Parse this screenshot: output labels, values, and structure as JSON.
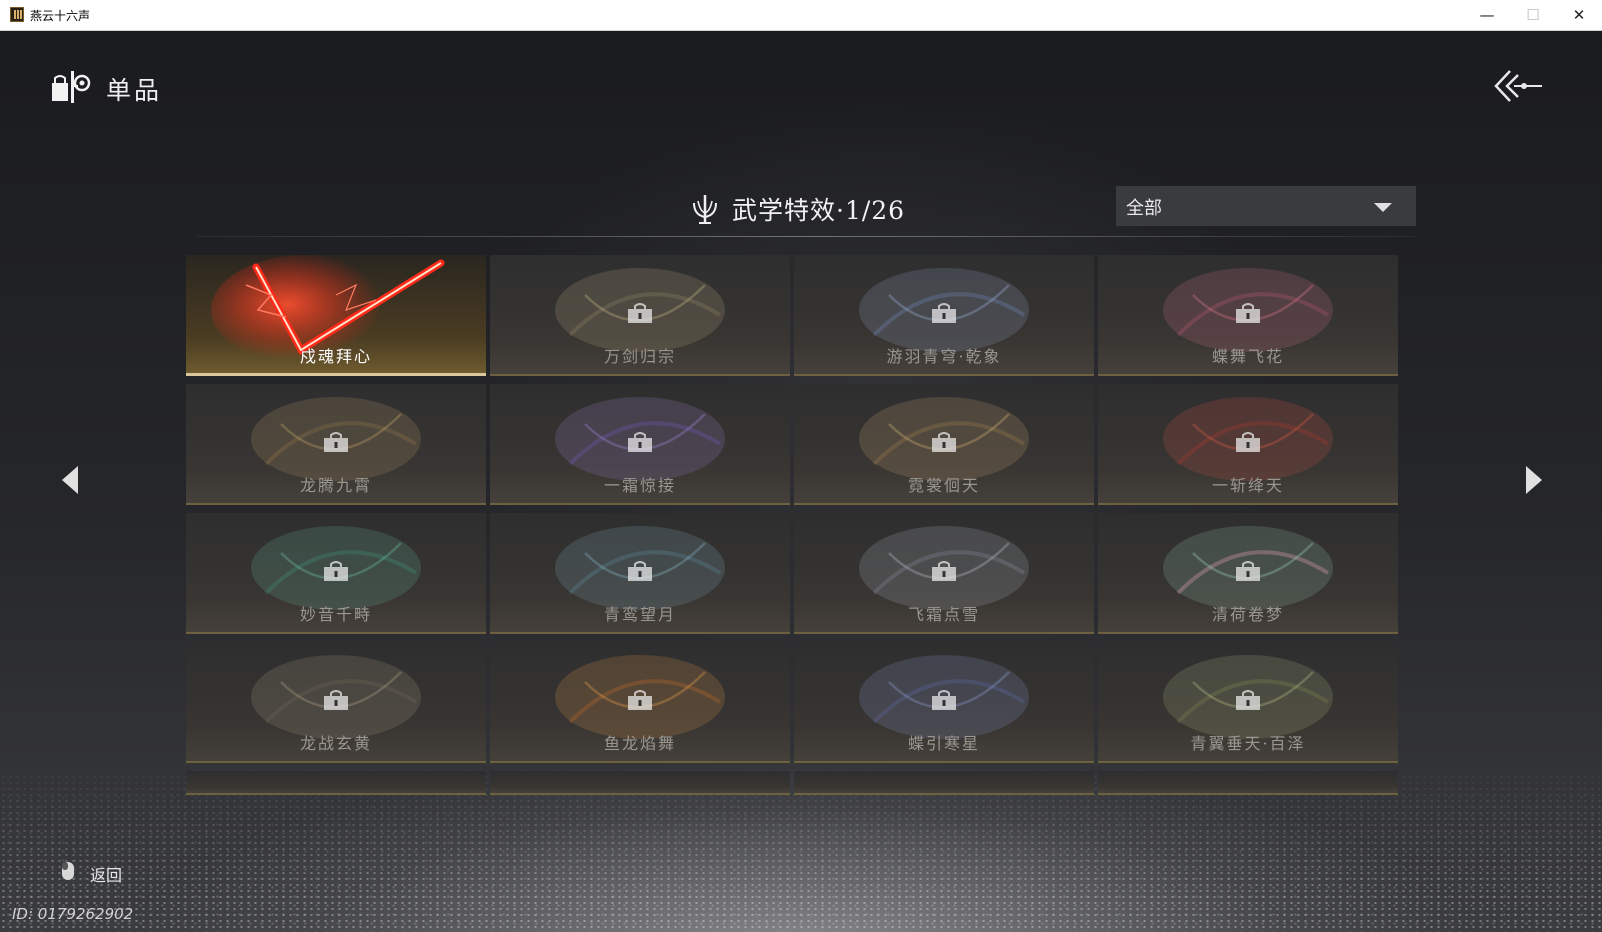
{
  "window": {
    "title": "燕云十六声",
    "minimize": "—",
    "maximize": "☐",
    "close": "✕"
  },
  "page": {
    "section_title": "单品",
    "header_title": "武学特效·1/26",
    "filter": {
      "selected": "全部"
    }
  },
  "grid": {
    "items": [
      {
        "label": "戍魂拜心",
        "selected": true,
        "locked": false
      },
      {
        "label": "万剑归宗",
        "selected": false,
        "locked": true
      },
      {
        "label": "游羽青穹·乾象",
        "selected": false,
        "locked": true
      },
      {
        "label": "蝶舞飞花",
        "selected": false,
        "locked": true
      },
      {
        "label": "龙腾九霄",
        "selected": false,
        "locked": true
      },
      {
        "label": "一霜惊接",
        "selected": false,
        "locked": true
      },
      {
        "label": "霓裳佪天",
        "selected": false,
        "locked": true
      },
      {
        "label": "一斩绛天",
        "selected": false,
        "locked": true
      },
      {
        "label": "妙音千畤",
        "selected": false,
        "locked": true
      },
      {
        "label": "青鸾望月",
        "selected": false,
        "locked": true
      },
      {
        "label": "飞霜点雪",
        "selected": false,
        "locked": true
      },
      {
        "label": "清荷卷梦",
        "selected": false,
        "locked": true
      },
      {
        "label": "龙战玄黄",
        "selected": false,
        "locked": true
      },
      {
        "label": "鱼龙焰舞",
        "selected": false,
        "locked": true
      },
      {
        "label": "蝶引寒星",
        "selected": false,
        "locked": true
      },
      {
        "label": "青翼垂天·百泽",
        "selected": false,
        "locked": true
      }
    ]
  },
  "footer": {
    "back_label": "返回",
    "user_id": "ID: 0179262902"
  },
  "colors": {
    "accent_gold": "#d9c79a",
    "effect_red": "#ff2a1a",
    "background": "#202124"
  },
  "icons": {
    "section": "item-shop-icon",
    "header": "martial-effect-icon",
    "back": "double-chevron-back-icon",
    "lock": "lock-icon",
    "mouse": "mouse-icon"
  }
}
